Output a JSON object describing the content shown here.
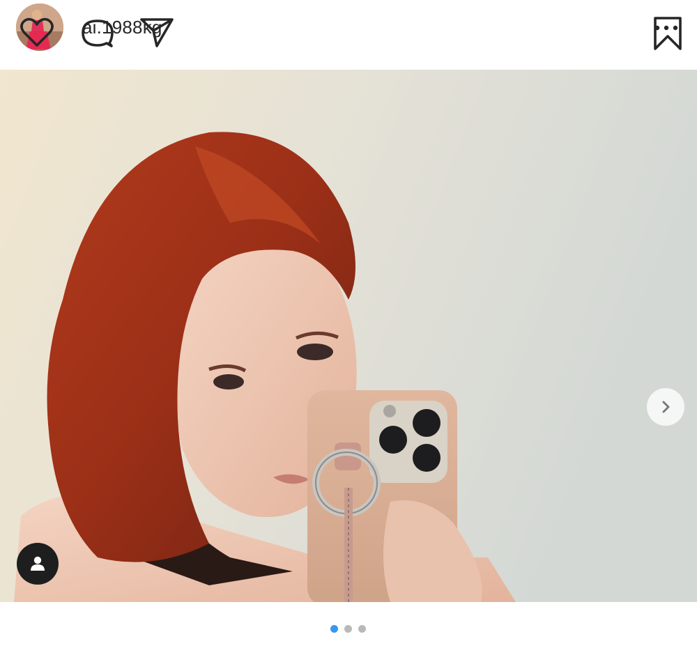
{
  "post": {
    "username": "ai.1988kg",
    "avatar_icon": "profile-avatar",
    "more_icon": "more-horizontal-icon"
  },
  "media": {
    "alt_kind": "selfie-photo",
    "next_icon": "chevron-right-icon",
    "user_tag_icon": "person-icon"
  },
  "carousel": {
    "total": 3,
    "active_index": 0,
    "active_color": "#3897f0",
    "inactive_color": "#b9b9b9"
  },
  "actions": {
    "like_icon": "heart-outline-icon",
    "comment_icon": "comment-bubble-icon",
    "share_icon": "paper-plane-icon",
    "save_icon": "bookmark-outline-icon"
  }
}
